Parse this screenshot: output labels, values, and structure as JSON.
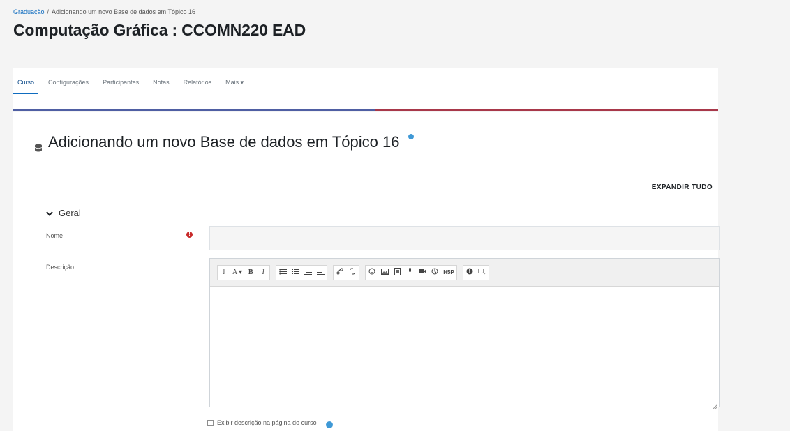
{
  "breadcrumb": {
    "root_label": "Graduação",
    "separator": "/",
    "current": "Adicionando um novo Base de dados em Tópico 16"
  },
  "page": {
    "title": "Computação Gráfica : CCOMN220 EAD"
  },
  "tabs": [
    {
      "label": "Curso",
      "active": true
    },
    {
      "label": "Configurações",
      "active": false
    },
    {
      "label": "Participantes",
      "active": false
    },
    {
      "label": "Notas",
      "active": false
    },
    {
      "label": "Relatórios",
      "active": false
    },
    {
      "label": "Mais ▾",
      "active": false
    }
  ],
  "form": {
    "heading": "Adicionando um novo Base de dados em Tópico 16",
    "expand_all": "EXPANDIR TUDO",
    "section_label": "Geral",
    "name_label": "Nome",
    "name_value": "",
    "description_label": "Descrição",
    "show_description_label": "Exibir descrição na página do curso"
  },
  "toolbar": {
    "collapse": "⇃",
    "font_style": "A ▾",
    "bold": "B",
    "italic": "I",
    "groups": [
      [
        "collapse",
        "font_style",
        "bold",
        "italic"
      ],
      [
        "unordered-list",
        "ordered-list",
        "indent",
        "outdent"
      ],
      [
        "link",
        "unlink"
      ],
      [
        "emoji",
        "image",
        "media-file",
        "record-audio",
        "record-video",
        "manage-files",
        "h5p"
      ],
      [
        "accessibility-checker",
        "screen-reader-helper"
      ]
    ]
  },
  "colors": {
    "link": "#0f6cbf",
    "required": "#c82a2a",
    "help": "#3f99d6",
    "tab_bar_left": "#4f5fa3",
    "tab_bar_right": "#a8384a"
  }
}
